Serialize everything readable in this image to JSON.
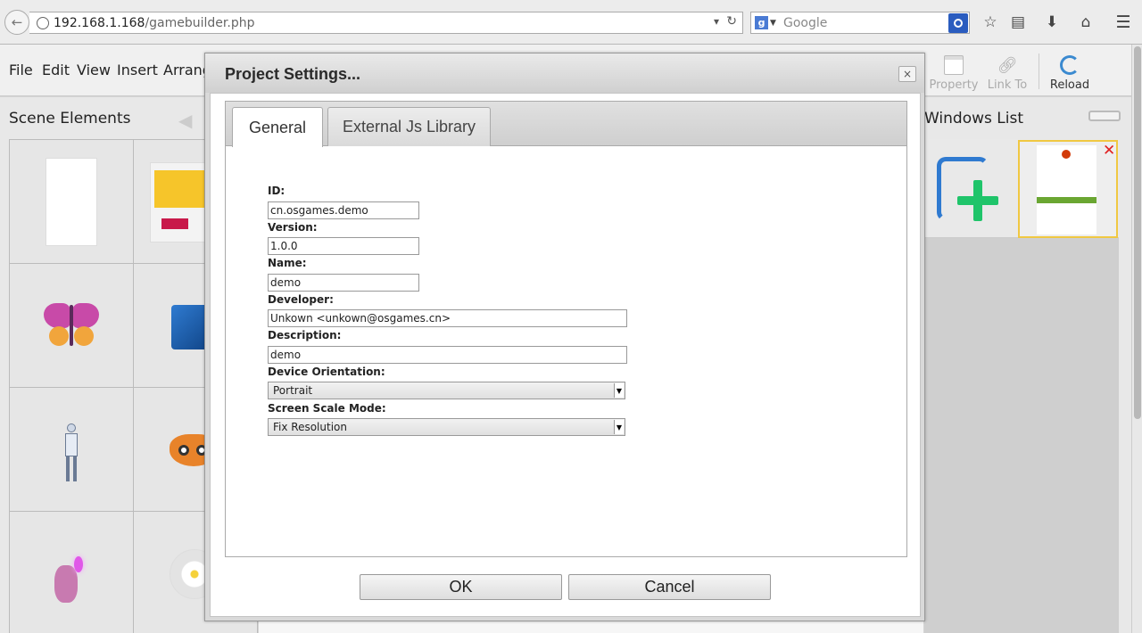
{
  "browser": {
    "url_host": "192.168.1.168",
    "url_path": "/gamebuilder.php",
    "search_placeholder": "Google"
  },
  "menubar": {
    "items": [
      "File",
      "Edit",
      "View",
      "Insert",
      "Arrang"
    ]
  },
  "toolbar": {
    "property_label": "Property",
    "linkto_label": "Link To",
    "reload_label": "Reload"
  },
  "scene_panel": {
    "title": "Scene Elements"
  },
  "windows_panel": {
    "title": "Windows List"
  },
  "dialog": {
    "title": "Project Settings...",
    "close_symbol": "×",
    "tabs": [
      {
        "label": "General",
        "active": true
      },
      {
        "label": "External Js Library",
        "active": false
      }
    ],
    "fields": {
      "id_label": "ID:",
      "id_value": "cn.osgames.demo",
      "version_label": "Version:",
      "version_value": "1.0.0",
      "name_label": "Name:",
      "name_value": "demo",
      "developer_label": "Developer:",
      "developer_value": "Unkown <unkown@osgames.cn>",
      "description_label": "Description:",
      "description_value": "demo",
      "orientation_label": "Device Orientation:",
      "orientation_value": "Portrait",
      "scale_label": "Screen Scale Mode:",
      "scale_value": "Fix Resolution"
    },
    "ok_label": "OK",
    "cancel_label": "Cancel"
  },
  "colors": {
    "reload_icon": "#3b8ad0",
    "add_window_frame": "#2f7ad0",
    "add_window_plus": "#1fc46a",
    "selected_window_border": "#f0c842",
    "window_close": "#e02020"
  }
}
